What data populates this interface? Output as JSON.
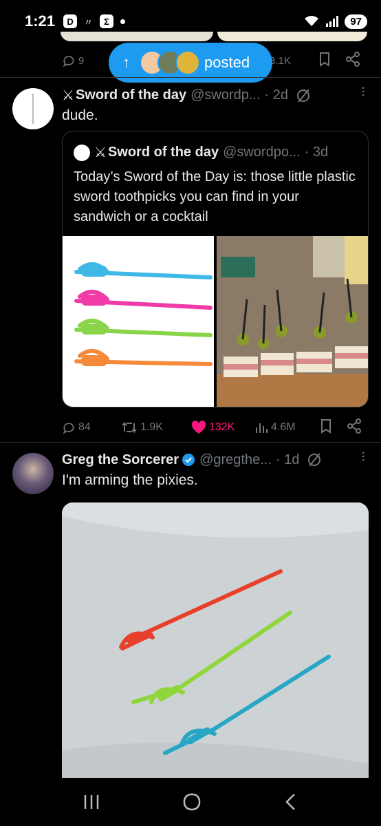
{
  "status_bar": {
    "time": "1:21",
    "battery": "97",
    "box_icon_label": "Σ"
  },
  "prev_tweet": {
    "replies": "9",
    "views": "3.1K"
  },
  "posted_pill": {
    "label": "posted"
  },
  "tweet1": {
    "name": "Sword of the day",
    "handle": "@swordp...",
    "time": "· 2d",
    "text": "dude.",
    "quote": {
      "name": "Sword of the day",
      "handle": "@swordpo...",
      "time": "· 3d",
      "text": "Today’s Sword of the Day is: those little plastic sword toothpicks you can find in your sandwich or a cocktail"
    },
    "actions": {
      "replies": "84",
      "reposts": "1.9K",
      "likes": "132K",
      "views": "4.6M"
    }
  },
  "tweet2": {
    "name": "Greg the Sorcerer",
    "handle": "@gregthe...",
    "time": "· 1d",
    "text": "I'm arming the pixies."
  },
  "colors": {
    "accent": "#1d9bf0",
    "like": "#f91880",
    "muted": "#71767b",
    "border": "#2f3336"
  }
}
